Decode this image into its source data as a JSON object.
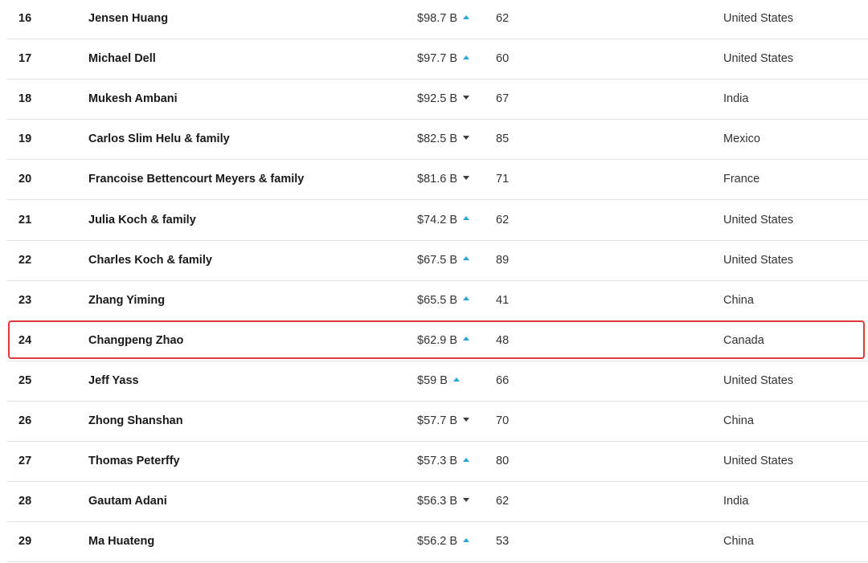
{
  "colors": {
    "up_arrow": "#28a6d8",
    "down_arrow": "#3c3c3c",
    "highlight_border": "#de3a3a",
    "row_divider": "#e3e3e3"
  },
  "highlighted_rank": "24",
  "rows": [
    {
      "rank": "16",
      "name": "Jensen Huang",
      "net_worth": "$98.7 B",
      "trend": "up",
      "age": "62",
      "country": "United States"
    },
    {
      "rank": "17",
      "name": "Michael Dell",
      "net_worth": "$97.7 B",
      "trend": "up",
      "age": "60",
      "country": "United States"
    },
    {
      "rank": "18",
      "name": "Mukesh Ambani",
      "net_worth": "$92.5 B",
      "trend": "down",
      "age": "67",
      "country": "India"
    },
    {
      "rank": "19",
      "name": "Carlos Slim Helu & family",
      "net_worth": "$82.5 B",
      "trend": "down",
      "age": "85",
      "country": "Mexico"
    },
    {
      "rank": "20",
      "name": "Francoise Bettencourt Meyers & family",
      "net_worth": "$81.6 B",
      "trend": "down",
      "age": "71",
      "country": "France"
    },
    {
      "rank": "21",
      "name": "Julia Koch & family",
      "net_worth": "$74.2 B",
      "trend": "up",
      "age": "62",
      "country": "United States"
    },
    {
      "rank": "22",
      "name": "Charles Koch & family",
      "net_worth": "$67.5 B",
      "trend": "up",
      "age": "89",
      "country": "United States"
    },
    {
      "rank": "23",
      "name": "Zhang Yiming",
      "net_worth": "$65.5 B",
      "trend": "up",
      "age": "41",
      "country": "China"
    },
    {
      "rank": "24",
      "name": "Changpeng Zhao",
      "net_worth": "$62.9 B",
      "trend": "up",
      "age": "48",
      "country": "Canada"
    },
    {
      "rank": "25",
      "name": "Jeff Yass",
      "net_worth": "$59 B",
      "trend": "up",
      "age": "66",
      "country": "United States"
    },
    {
      "rank": "26",
      "name": "Zhong Shanshan",
      "net_worth": "$57.7 B",
      "trend": "down",
      "age": "70",
      "country": "China"
    },
    {
      "rank": "27",
      "name": "Thomas Peterffy",
      "net_worth": "$57.3 B",
      "trend": "up",
      "age": "80",
      "country": "United States"
    },
    {
      "rank": "28",
      "name": "Gautam Adani",
      "net_worth": "$56.3 B",
      "trend": "down",
      "age": "62",
      "country": "India"
    },
    {
      "rank": "29",
      "name": "Ma Huateng",
      "net_worth": "$56.2 B",
      "trend": "up",
      "age": "53",
      "country": "China"
    }
  ]
}
